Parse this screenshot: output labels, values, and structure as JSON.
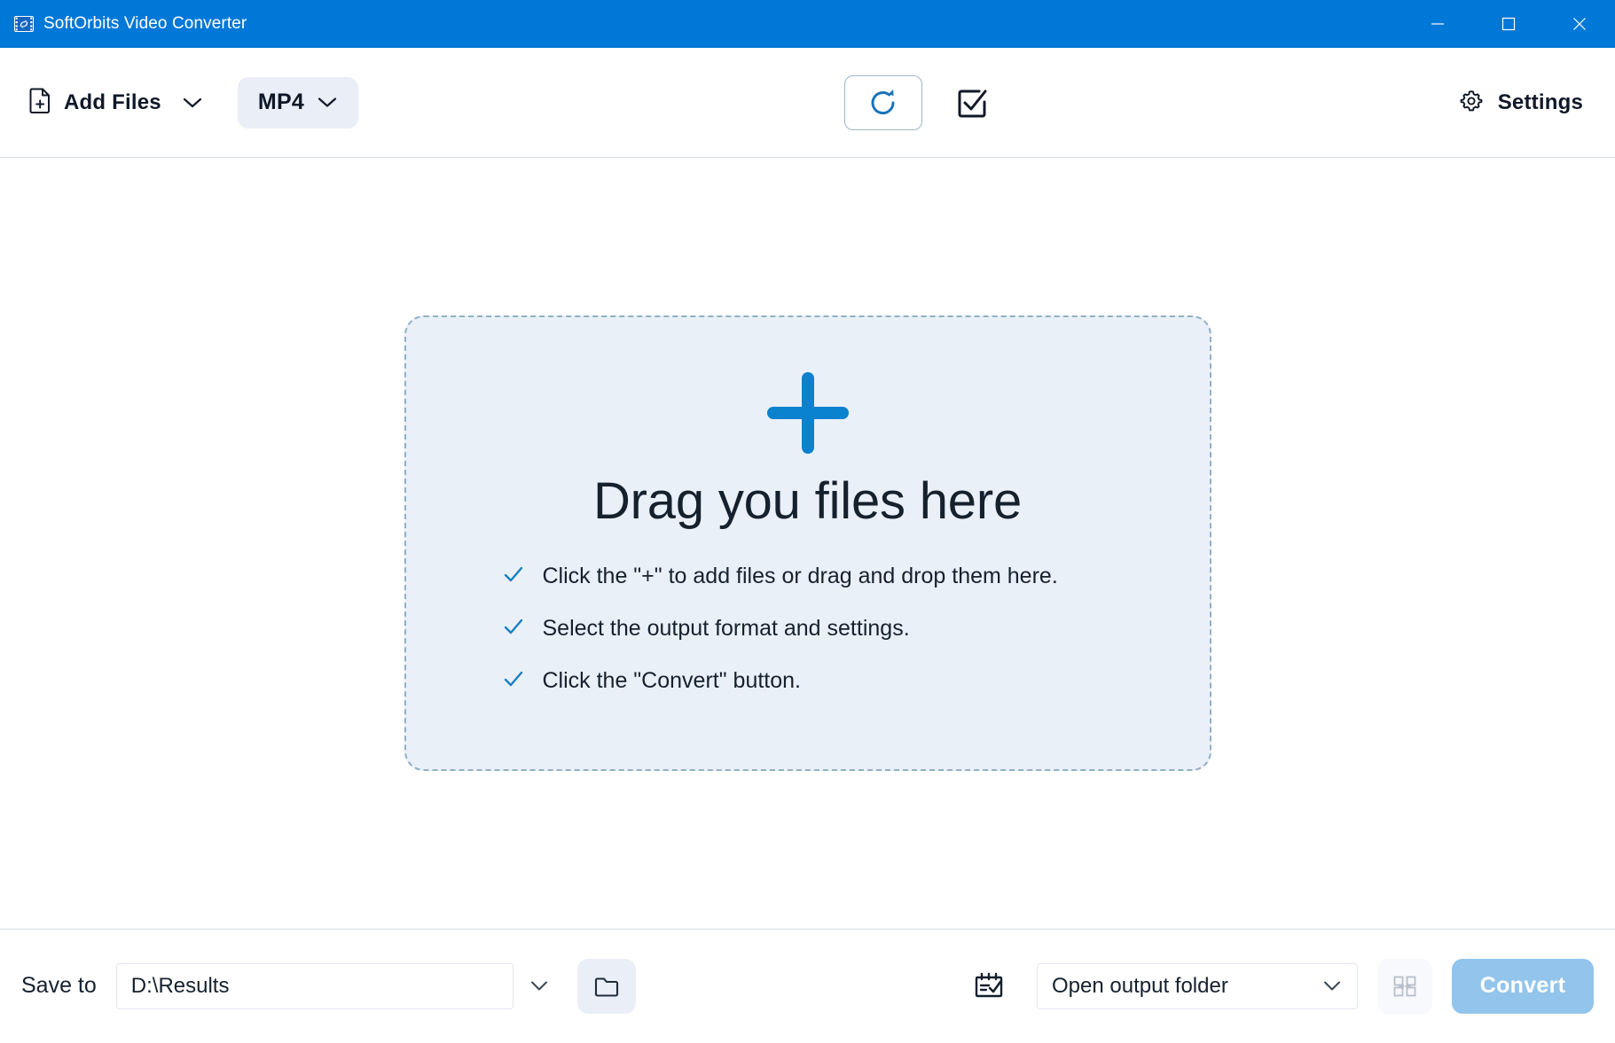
{
  "window": {
    "title": "SoftOrbits Video Converter",
    "app_icon": "video-film-icon",
    "controls": {
      "minimize": "minimize-icon",
      "maximize": "maximize-icon",
      "close": "close-icon"
    },
    "titlebar_color": "#0078D7"
  },
  "toolbar": {
    "add_files_label": "Add Files",
    "add_files_icon": "file-plus-icon",
    "add_files_chevron": "chevron-down-icon",
    "format_label": "MP4",
    "format_chevron": "chevron-down-icon",
    "refresh_icon": "refresh-rotate-icon",
    "select_all_icon": "checkbox-checked-icon",
    "settings_label": "Settings",
    "settings_icon": "gear-icon"
  },
  "dropzone": {
    "plus_icon": "plus-icon",
    "title": "Drag you files here",
    "items": [
      {
        "text": "Click the \"+\" to add files or drag and drop them here.",
        "icon": "check-icon"
      },
      {
        "text": "Select the output format and settings.",
        "icon": "check-icon"
      },
      {
        "text": "Click the \"Convert\" button.",
        "icon": "check-icon"
      }
    ],
    "fill_color": "#eaf0f8",
    "border_color": "#8fb0c6",
    "accent_color": "#0b82cd"
  },
  "bottombar": {
    "save_to_label": "Save to",
    "save_to_value": "D:\\Results",
    "save_to_placeholder": "D:\\Results",
    "history_chevron": "chevron-down-icon",
    "browse_icon": "folder-icon",
    "schedule_icon": "calendar-check-icon",
    "post_action_label": "Open output folder",
    "post_action_chevron": "chevron-down-icon",
    "merge_icon": "merge-arrows-icon",
    "convert_label": "Convert",
    "convert_color": "#93c5ec"
  }
}
